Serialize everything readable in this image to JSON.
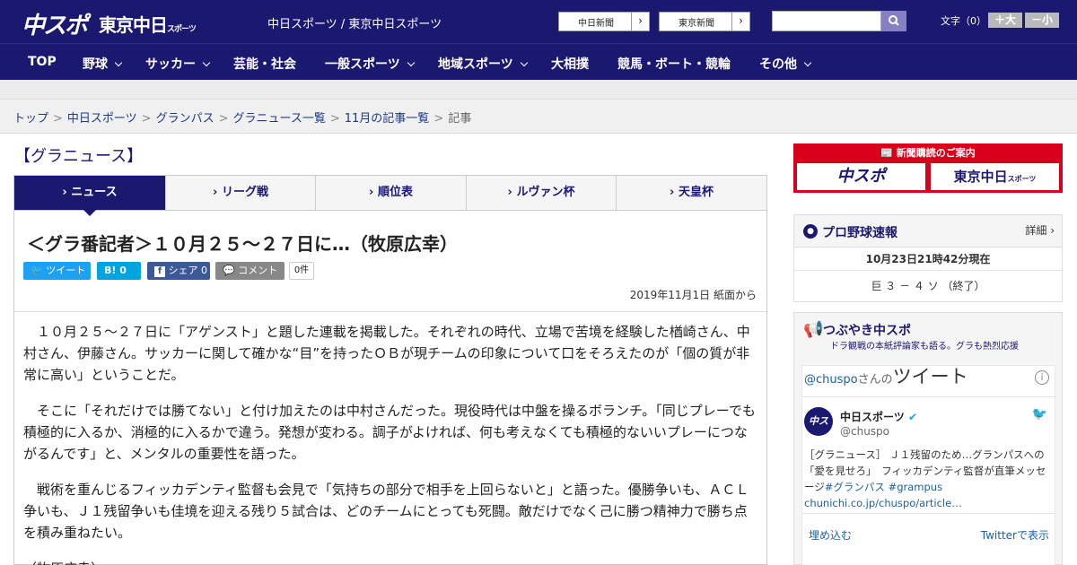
{
  "header": {
    "logo_chuspo": "中スポ",
    "logo_tokyo": "東京中日",
    "logo_tokyo_small": "スポーツ",
    "site_links": "中日スポーツ / 東京中日スポーツ",
    "btn_chunichi": "中日新聞",
    "btn_tokyo": "東京新聞",
    "search_placeholder": "",
    "font_size_label": "文字（0）",
    "font_bigger": "＋大",
    "font_smaller": "－小"
  },
  "nav": [
    {
      "label": "TOP"
    },
    {
      "label": "野球"
    },
    {
      "label": "サッカー"
    },
    {
      "label": "芸能・社会"
    },
    {
      "label": "一般スポーツ"
    },
    {
      "label": "地域スポーツ"
    },
    {
      "label": "大相撲"
    },
    {
      "label": "競馬・ボート・競輪"
    },
    {
      "label": "その他"
    }
  ],
  "breadcrumb": [
    "トップ",
    "中日スポーツ",
    "グランパス",
    "グラニュース一覧",
    "11月の記事一覧",
    "記事"
  ],
  "section_title": "【グラニュース】",
  "tabs": [
    "ニュース",
    "リーグ戦",
    "順位表",
    "ルヴァン杯",
    "天皇杯"
  ],
  "article": {
    "headline": "＜グラ番記者＞１０月２５～２７日に…（牧原広幸）",
    "share": {
      "tweet": "ツイート",
      "hatena": "B! 0",
      "facebook": "シェア 0",
      "comment": "コメント",
      "comment_count": "0件"
    },
    "date": "2019年11月1日 紙面から",
    "paragraphs": [
      "　１０月２５～２７日に「アゲンスト」と題した連載を掲載した。それぞれの時代、立場で苦境を経験した楢崎さん、中村さん、伊藤さん。サッカーに関して確かな“目”を持ったＯＢが現チームの印象について口をそろえたのが「個の質が非常に高い」ということだ。",
      "　そこに「それだけでは勝てない」と付け加えたのは中村さんだった。現役時代は中盤を操るボランチ。「同じプレーでも積極的に入るか、消極的に入るかで違う。発想が変わる。調子がよければ、何も考えなくても積極的ないいプレーにつながるんです」と、メンタルの重要性を語った。",
      "　戦術を重んじるフィッカデンティ監督も会見で「気持ちの部分で相手を上回らないと」と語った。優勝争いも、ＡＣＬ争いも、Ｊ１残留争いも佳境を迎える残り５試合は、どのチームにとっても死闘。敵だけでなく己に勝つ精神力で勝ち点を積み重ねたい。",
      "（牧原広幸）"
    ]
  },
  "sidebar": {
    "promo": {
      "title": "新聞購読のご案内",
      "left": "中スポ",
      "right": "東京中日",
      "right_small": "スポーツ"
    },
    "baseball": {
      "title": "プロ野球速報",
      "detail": "詳細 ›",
      "time": "10月23日21時42分現在",
      "score": "巨 ３ － ４ ソ （終了）"
    },
    "tsubuyaki": {
      "title": "つぶやき中スポ",
      "subtitle": "ドラ観戦の本紙評論家も語る。グラも熱烈応援",
      "handle_prefix": "@chuspo",
      "handle_suffix": "さんの",
      "tweets_label": "ツイート",
      "account_name": "中日スポーツ",
      "account_handle": "@chuspo",
      "tweet_text": "［グラニュース］ Ｊ１残留のため…グランパスへの「愛を見せろ」　フィッカデンティ監督が直筆メッセージ",
      "hashtags": "#グランパス #grampus",
      "link": "chunichi.co.jp/chuspo/article…",
      "embed": "埋め込む",
      "view_on": "Twitterで表示"
    }
  },
  "colors": {
    "navy": "#1b1870",
    "promo_red": "#d9001b",
    "twitter": "#1da1f2",
    "hatena": "#00a4de",
    "facebook": "#3b5998"
  }
}
